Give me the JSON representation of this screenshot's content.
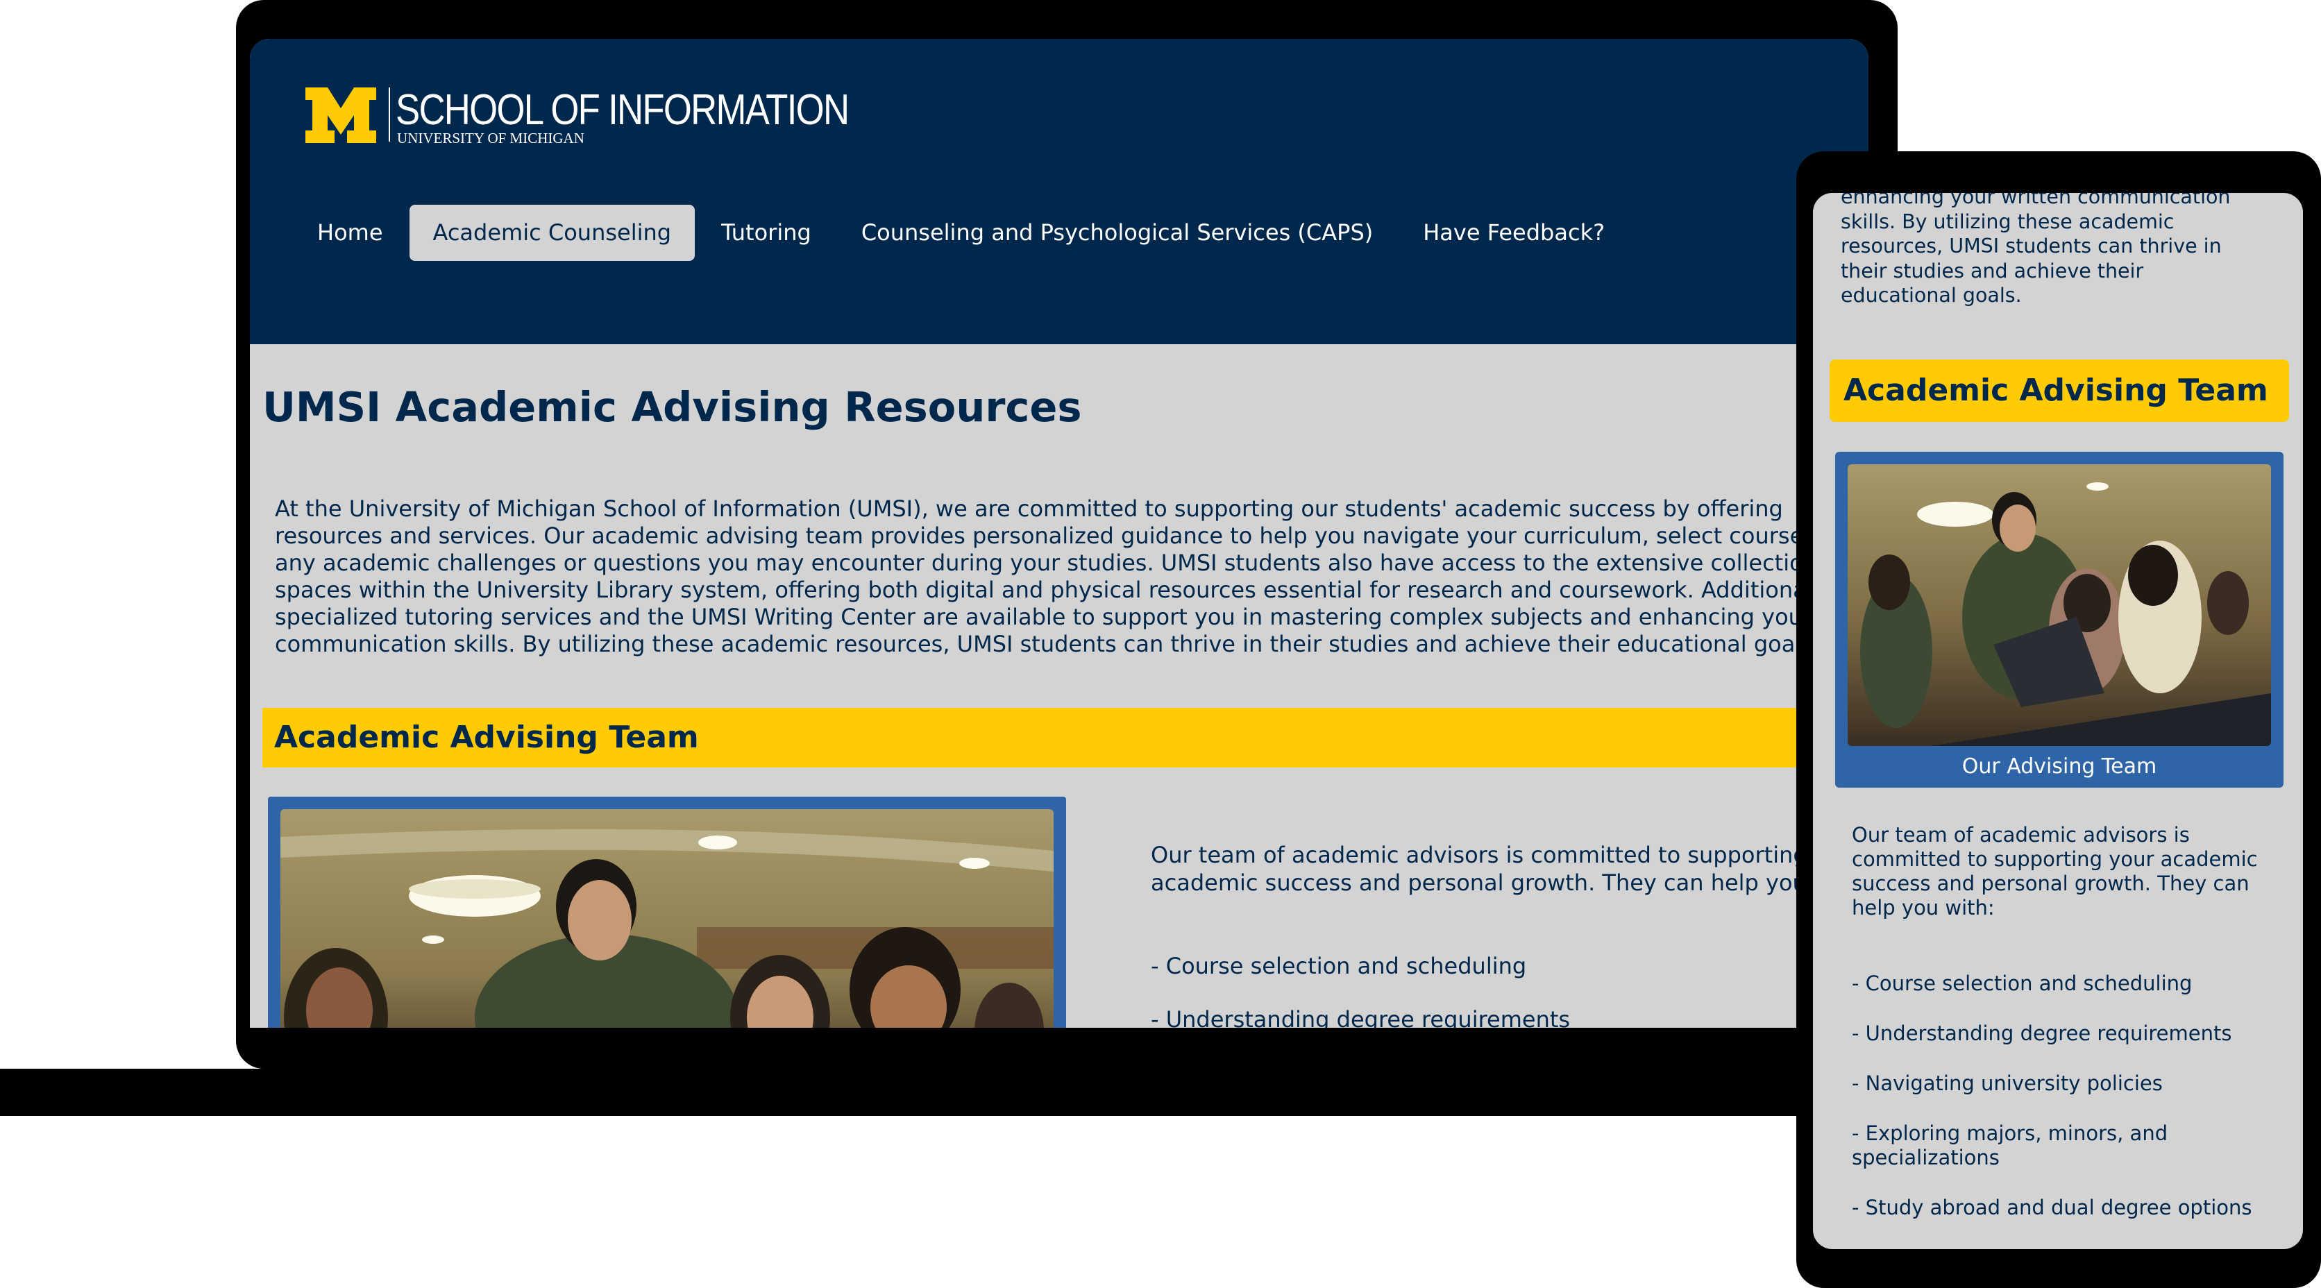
{
  "brand": {
    "title": "SCHOOL OF INFORMATION",
    "subtitle": "UNIVERSITY OF MICHIGAN",
    "colors": {
      "navy": "#00274c",
      "maize": "#ffcb05",
      "blue": "#2f65a7",
      "page": "#d3d3d3"
    }
  },
  "nav": {
    "items": [
      "Home",
      "Academic Counseling",
      "Tutoring",
      "Counseling and Psychological Services (CAPS)",
      "Have Feedback?"
    ],
    "active": "Academic Counseling"
  },
  "page": {
    "title": "UMSI Academic Advising Resources",
    "intro_lines": [
      "At the University of Michigan School of Information (UMSI), we are committed to supporting our students' academic success by offering",
      "resources and services. Our academic advising team provides personalized guidance to help you navigate your curriculum, select courses",
      "any academic challenges or questions you may encounter during your studies. UMSI students also have access to the extensive collectio",
      "spaces within the University Library system, offering both digital and physical resources essential for research and coursework. Additiona",
      "specialized tutoring services and the UMSI Writing Center are available to support you in mastering complex subjects and enhancing you",
      "communication skills. By utilizing these academic resources, UMSI students can thrive in their studies and achieve their educational goal"
    ]
  },
  "advising": {
    "heading": "Academic Advising Team",
    "text_lines": [
      "Our team of academic advisors is committed to supporting",
      "academic success and personal growth. They can help you"
    ],
    "list_items": [
      "- Course selection and scheduling",
      "- Understanding degree requirements"
    ]
  },
  "tablet": {
    "intro_lines": [
      "enhancing your written communication",
      "skills. By utilizing these academic",
      "resources, UMSI students can thrive in",
      "their studies and achieve their",
      "educational goals."
    ],
    "heading": "Academic Advising Team",
    "caption": "Our Advising Team",
    "text_lines": [
      "Our team of academic advisors is",
      "committed to supporting your academic",
      "success and personal growth. They can",
      "help you with:"
    ],
    "list_items": [
      "- Course selection and scheduling",
      "- Understanding degree requirements",
      "- Navigating university policies",
      "- Exploring majors, minors, and specializations",
      "- Study abroad and dual degree options"
    ]
  }
}
